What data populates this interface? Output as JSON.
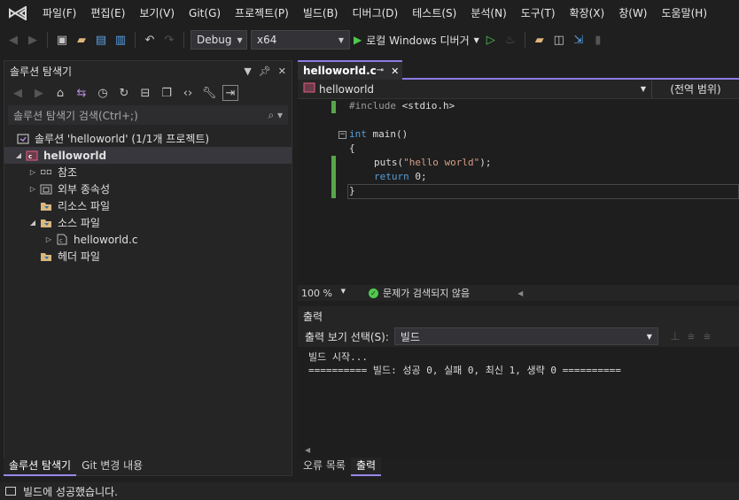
{
  "menu": [
    "파일(F)",
    "편집(E)",
    "보기(V)",
    "Git(G)",
    "프로젝트(P)",
    "빌드(B)",
    "디버그(D)",
    "테스트(S)",
    "분석(N)",
    "도구(T)",
    "확장(X)",
    "창(W)",
    "도움말(H)"
  ],
  "toolbar": {
    "config": "Debug",
    "platform": "x64",
    "run_label": "로컬 Windows 디버거"
  },
  "solution_explorer": {
    "title": "솔루션 탐색기",
    "search_placeholder": "솔루션 탐색기 검색(Ctrl+;)",
    "solution_label": "솔루션 'helloworld' (1/1개 프로젝트)",
    "project": "helloworld",
    "nodes": [
      "참조",
      "외부 종속성",
      "리소스 파일",
      "소스 파일",
      "helloworld.c",
      "헤더 파일"
    ]
  },
  "bottom_tabs_left": [
    "솔루션 탐색기",
    "Git 변경 내용"
  ],
  "editor": {
    "tab": "helloworld.c",
    "nav_file": "helloworld",
    "nav_scope": "(전역 범위)",
    "zoom": "100 %",
    "issues": "문제가 검색되지 않음",
    "code": {
      "l1_pp": "#include",
      "l1_inc": " <stdio.h>",
      "l3_kw": "int",
      "l3_rest": " main()",
      "l4": "{",
      "l5_fn": "puts(",
      "l5_str": "\"hello world\"",
      "l5_end": ");",
      "l6_kw": "return",
      "l6_rest": " 0;",
      "l7": "}"
    }
  },
  "output": {
    "title": "출력",
    "select_label": "출력 보기 선택(S):",
    "select_value": "빌드",
    "line1": "빌드 시작...",
    "line2": "========== 빌드: 성공 0, 실패 0, 최신 1, 생략 0 =========="
  },
  "bottom_tabs_right": [
    "오류 목록",
    "출력"
  ],
  "status": "빌드에 성공했습니다.",
  "colors": {
    "accent": "#8b7be2",
    "run_green": "#4ec94e",
    "change_bar": "#57a64a"
  }
}
